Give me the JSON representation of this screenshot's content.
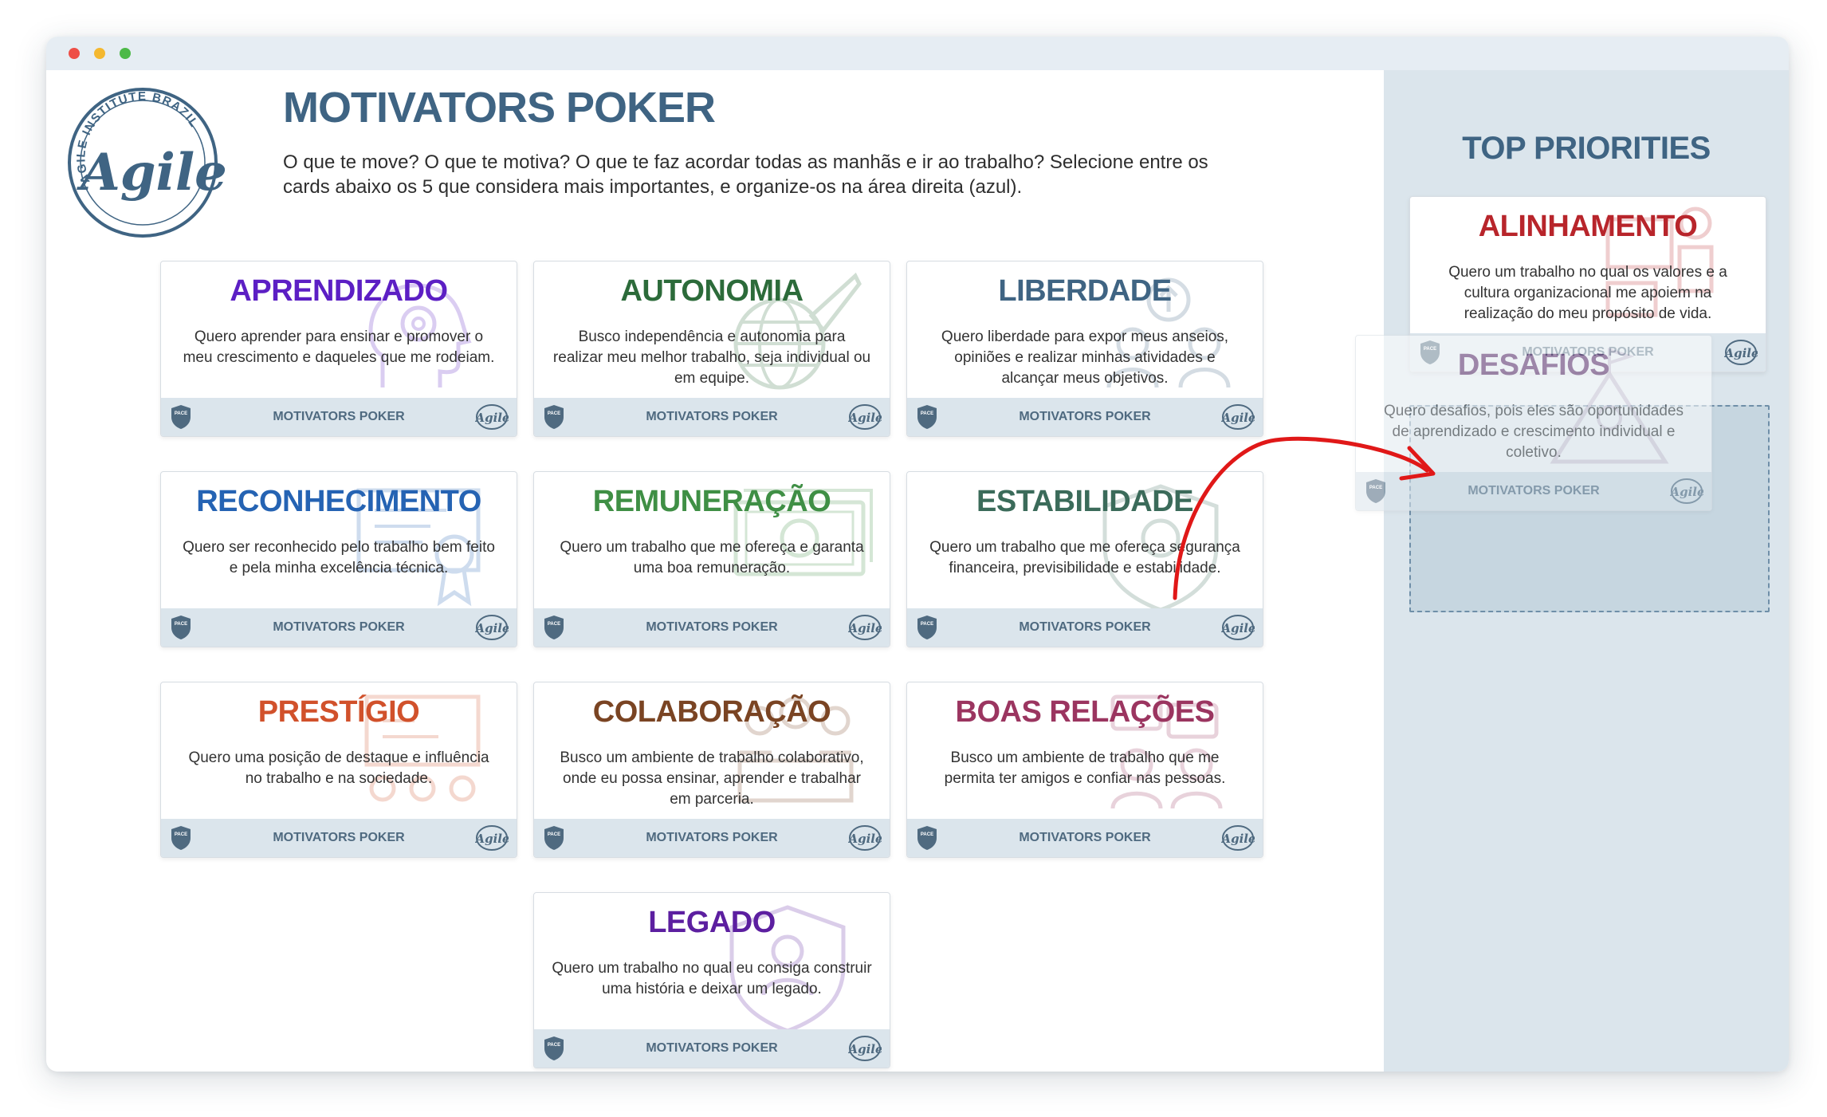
{
  "header": {
    "title": "MOTIVATORS POKER",
    "subtitle": "O que te move? O que te motiva? O que te faz acordar todas as manhãs e ir ao trabalho? Selecione entre os cards abaixo os 5 que considera mais importantes, e organize-os na área direita (azul).",
    "logo_ring_text": "AGILE INSTITUTE BRAZIL",
    "logo_word": "Agile"
  },
  "card_footer": {
    "label": "MOTIVATORS POKER",
    "badge_text": "PACE",
    "agile_mark": "Agile"
  },
  "cards": [
    {
      "title": "APRENDIZADO",
      "desc": "Quero aprender para ensinar e promover o meu crescimento e daqueles que me rodeiam.",
      "color": "#5c1fc4",
      "icon": "head-gears-icon"
    },
    {
      "title": "AUTONOMIA",
      "desc": "Busco independência e autonomia para realizar meu melhor trabalho, seja individual ou em equipe.",
      "color": "#2c6b3a",
      "icon": "globe-rocket-icon"
    },
    {
      "title": "LIBERDADE",
      "desc": "Quero liberdade para expor meus anseios, opiniões e realizar minhas atividades e alcançar meus objetivos.",
      "color": "#3f6483",
      "icon": "people-arrow-icon"
    },
    {
      "title": "RECONHECIMENTO",
      "desc": "Quero ser reconhecido pelo trabalho bem feito e pela minha excelência técnica.",
      "color": "#2563b3",
      "icon": "certificate-icon"
    },
    {
      "title": "REMUNERAÇÃO",
      "desc": "Quero um trabalho que me ofereça e garanta uma boa remuneração.",
      "color": "#3f8f45",
      "icon": "money-icon"
    },
    {
      "title": "ESTABILIDADE",
      "desc": "Quero um trabalho que me ofereça segurança financeira, previsibilidade e estabilidade.",
      "color": "#3b6b5a",
      "icon": "shield-icon"
    },
    {
      "title": "PRESTÍGIO",
      "desc": "Quero uma posição de destaque e influência no trabalho e na sociedade.",
      "color": "#d1512b",
      "icon": "presentation-icon"
    },
    {
      "title": "COLABORAÇÃO",
      "desc": "Busco um ambiente de trabalho colaborativo, onde eu possa ensinar, aprender e trabalhar em parceria.",
      "color": "#7a4423",
      "icon": "team-icon"
    },
    {
      "title": "BOAS RELAÇÕES",
      "desc": "Busco um ambiente de trabalho que me permita ter amigos e confiar nas pessoas.",
      "color": "#9b3560",
      "icon": "chat-people-icon"
    },
    {
      "title": "LEGADO",
      "desc": "Quero um trabalho no qual eu consiga construir uma história e deixar um legado.",
      "color": "#5c1fa0",
      "icon": "shield-person-icon"
    }
  ],
  "sidebar": {
    "title": "TOP PRIORITIES",
    "cards": [
      {
        "title": "ALINHAMENTO",
        "desc": "Quero um trabalho no qual os valores e a cultura organizacional me apoiem na realização do meu propósito de vida.",
        "color": "#b8252b",
        "icon": "person-board-icon"
      }
    ],
    "dragging_card": {
      "title": "DESAFIOS",
      "desc": "Quero desafios, pois eles são oportunidades de aprendizado e crescimento individual e coletivo.",
      "color": "#6b3a73",
      "icon": "mountain-icon"
    }
  },
  "colors": {
    "brand": "#3f6483",
    "sidebar_bg": "#dbe5ec",
    "footer_bg": "#dbe5ec",
    "arrow": "#e01818"
  }
}
